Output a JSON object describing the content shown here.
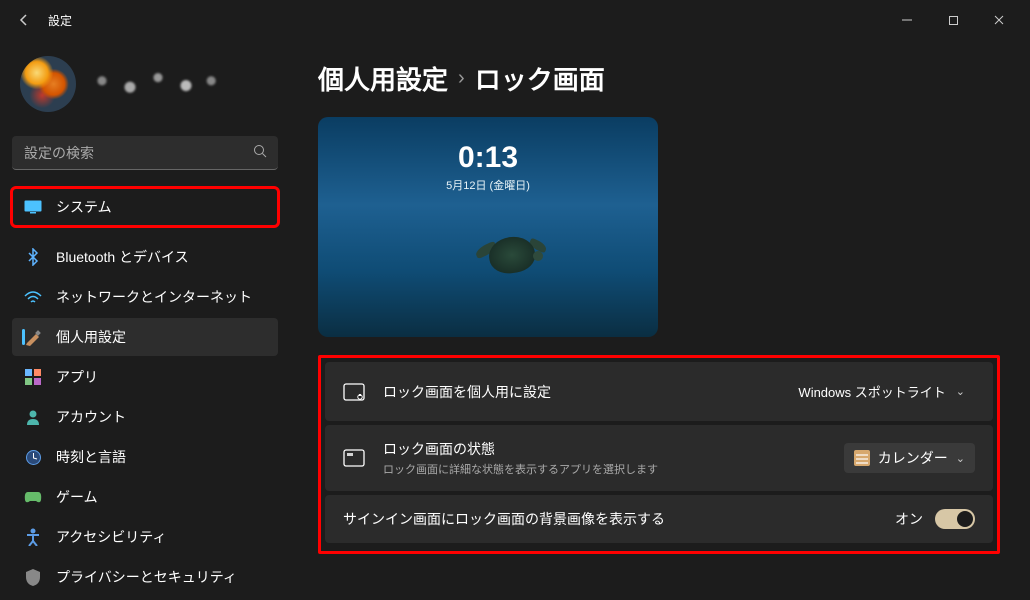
{
  "title": "設定",
  "breadcrumb": {
    "parent": "個人用設定",
    "sep": "›",
    "current": "ロック画面"
  },
  "search": {
    "placeholder": "設定の検索"
  },
  "nav": [
    {
      "label": "システム",
      "icon": "system",
      "highlighted": true
    },
    {
      "label": "Bluetooth とデバイス",
      "icon": "bluetooth"
    },
    {
      "label": "ネットワークとインターネット",
      "icon": "network"
    },
    {
      "label": "個人用設定",
      "icon": "personalization",
      "active": true
    },
    {
      "label": "アプリ",
      "icon": "apps"
    },
    {
      "label": "アカウント",
      "icon": "accounts"
    },
    {
      "label": "時刻と言語",
      "icon": "time"
    },
    {
      "label": "ゲーム",
      "icon": "gaming"
    },
    {
      "label": "アクセシビリティ",
      "icon": "accessibility"
    },
    {
      "label": "プライバシーとセキュリティ",
      "icon": "privacy"
    }
  ],
  "preview": {
    "time": "0:13",
    "date": "5月12日 (金曜日)"
  },
  "rows": {
    "personalize": {
      "title": "ロック画面を個人用に設定",
      "value": "Windows スポットライト"
    },
    "status": {
      "title": "ロック画面の状態",
      "subtitle": "ロック画面に詳細な状態を表示するアプリを選択します",
      "value": "カレンダー"
    },
    "signin": {
      "title": "サインイン画面にロック画面の背景画像を表示する",
      "toggle_label": "オン"
    }
  }
}
